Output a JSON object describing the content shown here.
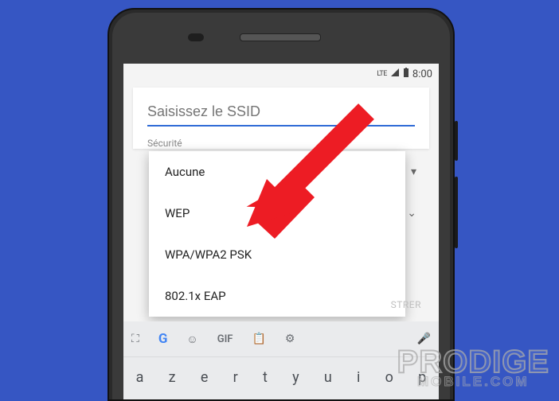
{
  "statusbar": {
    "time": "8:00",
    "signal": "LTE"
  },
  "wifi_dialog": {
    "ssid_placeholder": "Saisissez le SSID",
    "security_label": "Sécurité",
    "options": [
      "Aucune",
      "WEP",
      "WPA/WPA2 PSK",
      "802.1x EAP"
    ],
    "save_label": "STRER"
  },
  "keyboard": {
    "gif_label": "GIF",
    "row1": [
      "a",
      "z",
      "e",
      "r",
      "t",
      "y",
      "u",
      "i",
      "o",
      "p"
    ]
  },
  "watermark": {
    "line1": "PRODIGE",
    "line2": "MOBILE.COM"
  }
}
